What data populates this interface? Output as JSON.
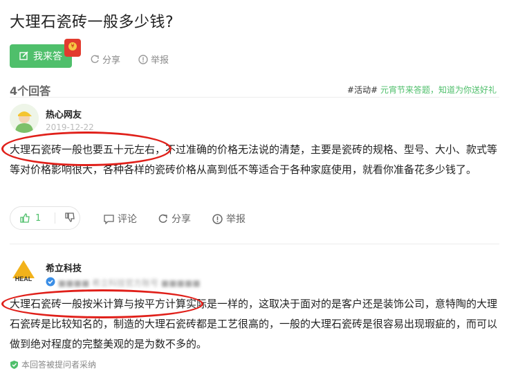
{
  "question": {
    "title": "大理石瓷砖一般多少钱?"
  },
  "actions": {
    "answer_label": "我来答",
    "share_label": "分享",
    "report_label": "举报",
    "redpacket_icon": "red-envelope-icon"
  },
  "answers_header": {
    "count_label": "4个回答",
    "promo_tag": "#活动#",
    "promo_text": " 元宵节来答题，知道为你送好礼"
  },
  "answers": [
    {
      "author": "热心网友",
      "date": "2019-12-22",
      "text": "大理石瓷砖一般也要五十元左右，不过准确的价格无法说的清楚，主要是瓷砖的规格、型号、大小、款式等等对价格影响很大，各种各样的瓷砖价格从高到低不等适合于各种家庭使用，就看你准备花多少钱了。",
      "likes": "1",
      "comment_label": "评论",
      "share_label": "分享",
      "report_label": "举报"
    },
    {
      "author": "希立科技",
      "meta_blurred": "■■■■ 希立科技官方账号 ■■■■■",
      "text": "大理石瓷砖一般按米计算与按平方计算实际是一样的，这取决于面对的是客户还是装饰公司，意特陶的大理石瓷砖是比较知名的，制造的大理石瓷砖都是工艺很高的，一般的大理石瓷砖是很容易出现瑕疵的，而可以做到绝对程度的完整美观的是为数不多的。",
      "adopted_label": "本回答被提问者采纳"
    }
  ],
  "colors": {
    "accent": "#4fbf6b",
    "annotation": "#e0201a"
  }
}
